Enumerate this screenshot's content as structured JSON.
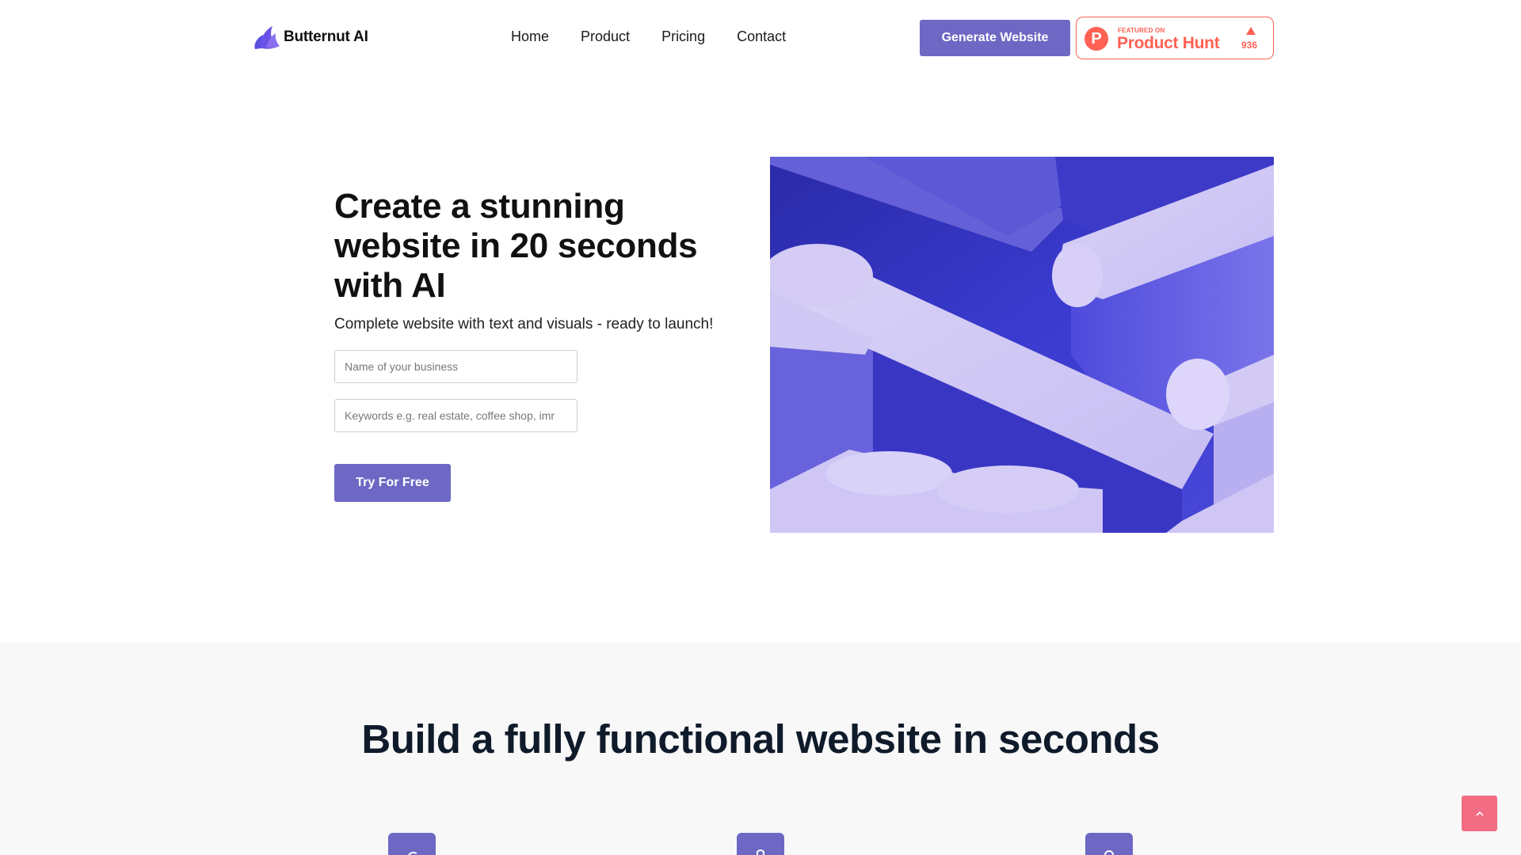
{
  "header": {
    "brand": "Butternut AI",
    "nav": [
      {
        "label": "Home"
      },
      {
        "label": "Product"
      },
      {
        "label": "Pricing"
      },
      {
        "label": "Contact"
      }
    ],
    "cta_label": "Generate Website",
    "product_hunt": {
      "featured_label": "FEATURED ON",
      "name": "Product Hunt",
      "upvotes": "936",
      "brand_color": "#ff6154"
    }
  },
  "hero": {
    "title": "Create a stunning website in 20 seconds with AI",
    "subtitle": "Complete website with text and visuals - ready to launch!",
    "business_name": {
      "value": "",
      "placeholder": "Name of your business"
    },
    "keywords": {
      "value": "",
      "placeholder": "Keywords e.g. real estate, coffee shop, imr"
    },
    "cta_label": "Try For Free",
    "image_description": "abstract purple 3D pill shapes"
  },
  "features": {
    "title": "Build a fully functional website in seconds",
    "icons": [
      "feature-icon-1",
      "feature-icon-2",
      "feature-icon-3"
    ]
  },
  "scroll_top_icon": "chevron-up-icon",
  "colors": {
    "accent": "#6e68c4",
    "product_hunt": "#ff6154",
    "scroll_top": "#f26d82",
    "features_bg": "#f8f8f9"
  }
}
